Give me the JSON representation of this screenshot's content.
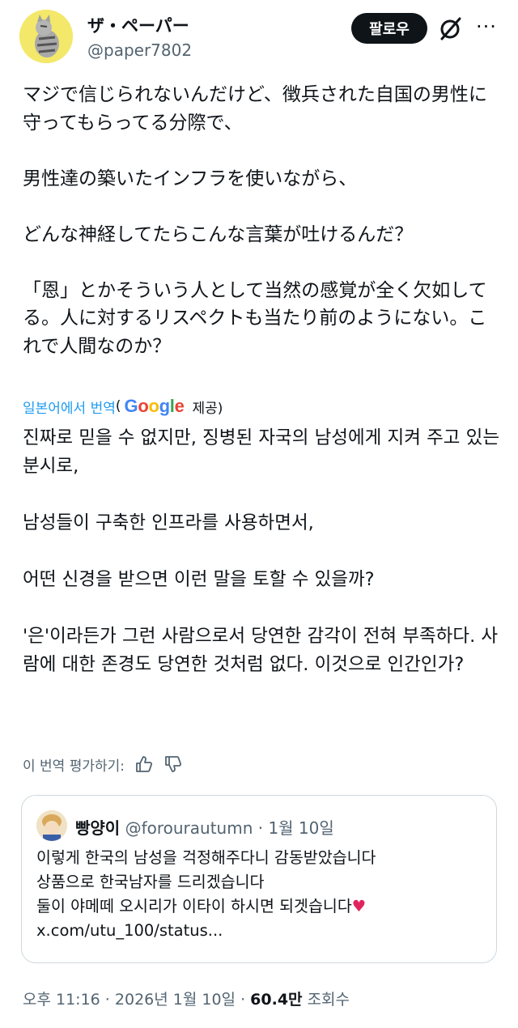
{
  "author": {
    "name": "ザ・ペーパー",
    "handle": "@paper7802",
    "avatar_color": "#f3e86a"
  },
  "actions": {
    "follow_label": "팔로우",
    "grok_icon": "grok-icon",
    "more_icon": "more-icon"
  },
  "tweet": {
    "text": "マジで信じられないんだけど、徴兵された自国の男性に守ってもらってる分際で、\n\n男性達の築いたインフラを使いながら、\n\nどんな神経してたらこんな言葉が吐けるんだ？\n\n「恩」とかそういう人として当然の感覚が全く欠如してる。人に対するリスペクトも当たり前のようにない。これで人間なのか？"
  },
  "translation": {
    "label": "일본어에서 번역",
    "open_paren": "(",
    "provider": "Google",
    "provided": "제공)",
    "text": "진짜로 믿을 수 없지만, 징병된 자국의 남성에게 지켜 주고 있는 분시로,\n\n남성들이 구축한 인프라를 사용하면서,\n\n어떤 신경을 받으면 이런 말을 토할 수 있을까?\n\n'은'이라든가 그런 사람으로서 당연한 감각이 전혀 부족하다. 사람에 대한 존경도 당연한 것처럼 없다. 이것으로 인간인가?",
    "rate_label": "이 번역 평가하기:",
    "thumbs_up_icon": "thumbs-up-icon",
    "thumbs_down_icon": "thumbs-down-icon"
  },
  "quote": {
    "name": "빵양이",
    "handle": "@forourautumn",
    "dot": "·",
    "date": "1월 10일",
    "text": "이렇게 한국의 남성을 걱정해주다니 감동받았습니다\n상품으로 한국남자를 드리겠습니다\n둘이 야메떼 오시리가 이타이 하시면 되겟습니다",
    "heart": "♥",
    "link": "x.com/utu_100/status..."
  },
  "meta": {
    "time": "오후 11:16",
    "sep1": " · ",
    "date": "2026년 1월 10일",
    "sep2": " · ",
    "views": "60.4만",
    "views_label": "조회수"
  },
  "colors": {
    "link": "#1d9bf0",
    "secondary": "#536471",
    "heart": "#e0245e"
  }
}
